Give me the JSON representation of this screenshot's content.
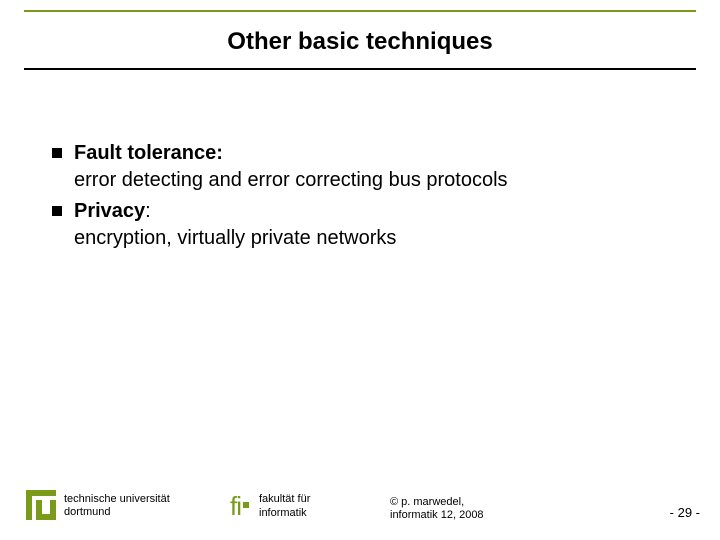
{
  "title": "Other basic techniques",
  "bullets": [
    {
      "head": "Fault tolerance:",
      "body": "error detecting and error correcting bus protocols"
    },
    {
      "head": "Privacy",
      "body": "encryption, virtually private networks"
    }
  ],
  "footer": {
    "tu": {
      "line1": "technische universität",
      "line2": "dortmund"
    },
    "fi": {
      "line1": "fakultät für",
      "line2": "informatik"
    },
    "copy": {
      "line1": "© p. marwedel,",
      "line2": "informatik 12,  2008"
    },
    "page": "-  29 -"
  }
}
